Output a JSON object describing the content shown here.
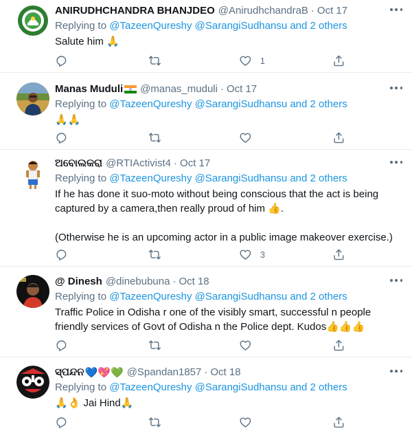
{
  "reply_prefix": "Replying to",
  "tweets": [
    {
      "name": "ANIRUDHCHANDRA BHANJDEO",
      "badge": "",
      "handle": "@AnirudhchandraB",
      "date": "Oct 17",
      "reply_to": "@TazeenQureshy @SarangiSudhansu and 2 others",
      "lines": [
        "Salute him 🙏"
      ],
      "replies": "",
      "retweets": "",
      "likes": "1",
      "avatar": "green-emblem"
    },
    {
      "name": "Manas Muduli",
      "badge": "",
      "handle": "@manas_muduli",
      "date": "Oct 17",
      "reply_to": "@TazeenQureshy @SarangiSudhansu and 2 others",
      "lines": [
        "🙏🙏"
      ],
      "replies": "",
      "retweets": "",
      "likes": "",
      "avatar": "photo-person-outdoor"
    },
    {
      "name": "ଅବୋଲକରା",
      "badge": "",
      "handle": "@RTIActivist4",
      "date": "Oct 17",
      "reply_to": "@TazeenQureshy @SarangiSudhansu and 2 others",
      "lines": [
        "If he has done it suo-moto without being conscious that the act is being",
        "captured by a camera,then really proud of him 👍.",
        "",
        "(Otherwise he is an upcoming actor in a public image makeover exercise.)"
      ],
      "replies": "",
      "retweets": "",
      "likes": "3",
      "avatar": "cartoon-boy"
    },
    {
      "name": "@ Dinesh",
      "badge": "",
      "handle": "@dinebubuna",
      "date": "Oct 18",
      "reply_to": "@TazeenQureshy @SarangiSudhansu and 2 others",
      "lines": [
        "Traffic Police in Odisha r one of the visibly smart, successful n  people",
        "friendly services of Govt of Odisha  n the Police dept. Kudos👍👍👍"
      ],
      "replies": "",
      "retweets": "",
      "likes": "",
      "avatar": "photo-person-dark"
    },
    {
      "name": "ସ୍ପନ୍ଦନ",
      "badge": "💙💖💚",
      "handle": "@Spandan1857",
      "date": "Oct 18",
      "reply_to": "@TazeenQureshy @SarangiSudhansu and 2 others",
      "lines": [
        "🙏👌 Jai Hind🙏"
      ],
      "replies": "",
      "retweets": "",
      "likes": "",
      "avatar": "jagannath-face"
    }
  ]
}
